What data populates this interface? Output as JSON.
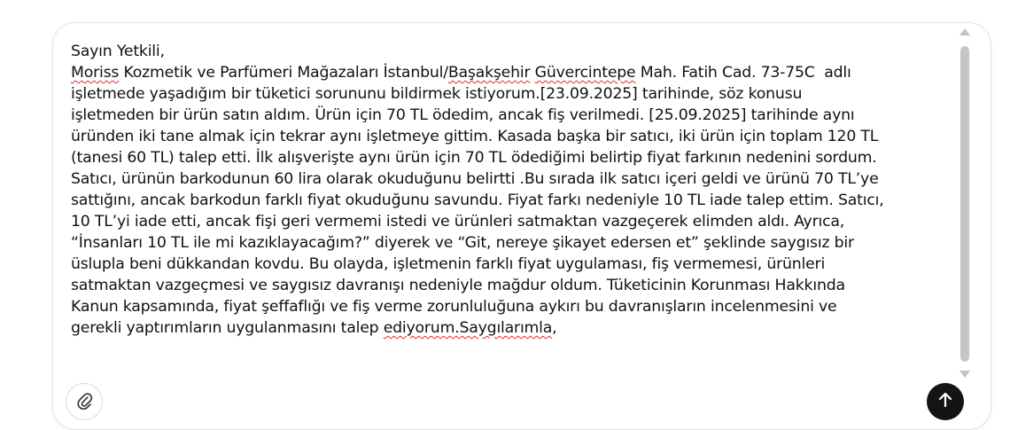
{
  "composer": {
    "message_lines": [
      [
        "Sayın Yetkili,"
      ],
      [
        "Moriss",
        " Kozmetik ve Parfümeri Mağazaları İstanbul/",
        "Başakşehir",
        " ",
        "Güvercintepe",
        " Mah. Fatih Cad. 73-75C  adlı"
      ],
      [
        "işletmede yaşadığım bir tüketici sorununu bildirmek istiyorum.[23.09.2025] tarihinde, söz konusu"
      ],
      [
        "işletmeden bir ürün satın aldım. Ürün için 70 TL ödedim, ancak fiş verilmedi. [25.09.2025] tarihinde aynı"
      ],
      [
        "üründen iki tane almak için tekrar aynı işletmeye gittim. Kasada başka bir satıcı, iki ürün için toplam 120 TL"
      ],
      [
        "(tanesi 60 TL) talep etti. İlk alışverişte aynı ürün için 70 TL ödediğimi belirtip fiyat farkının nedenini sordum."
      ],
      [
        "Satıcı, ürünün barkodunun 60 lira olarak okuduğunu belirtti .Bu sırada ilk satıcı içeri geldi ve ürünü 70 TL’ye"
      ],
      [
        "sattığını, ancak barkodun farklı fiyat okuduğunu savundu. Fiyat farkı nedeniyle 10 TL iade talep ettim. Satıcı,"
      ],
      [
        "10 TL’yi iade etti, ancak fişi geri vermemi istedi ve ürünleri satmaktan vazgeçerek elimden aldı. Ayrıca,"
      ],
      [
        "“İnsanları 10 TL ile mi kazıklayacağım?” diyerek ve “Git, nereye şikayet edersen et” şeklinde saygısız bir"
      ],
      [
        "üslupla beni dükkandan kovdu. Bu olayda, işletmenin farklı fiyat uygulaması, fiş vermemesi, ürünleri"
      ],
      [
        "satmaktan vazgeçmesi ve saygısız davranışı nedeniyle mağdur oldum. Tüketicinin Korunması Hakkında"
      ],
      [
        "Kanun kapsamında, fiyat şeffaflığı ve fiş verme zorunluluğuna aykırı bu davranışların incelenmesini ve"
      ],
      [
        "gerekli yaptırımların uygulanmasını talep ",
        "ediyorum.Saygılarımla",
        ","
      ]
    ],
    "misspelled_words": [
      "Moriss",
      "Başakşehir",
      "Güvercintepe",
      "ediyorum.Saygılarımla"
    ],
    "attach_icon": "paperclip-icon",
    "send_icon": "arrow-up-icon",
    "spellcheck_color": "#e02b2b",
    "send_button_color": "#141414"
  }
}
